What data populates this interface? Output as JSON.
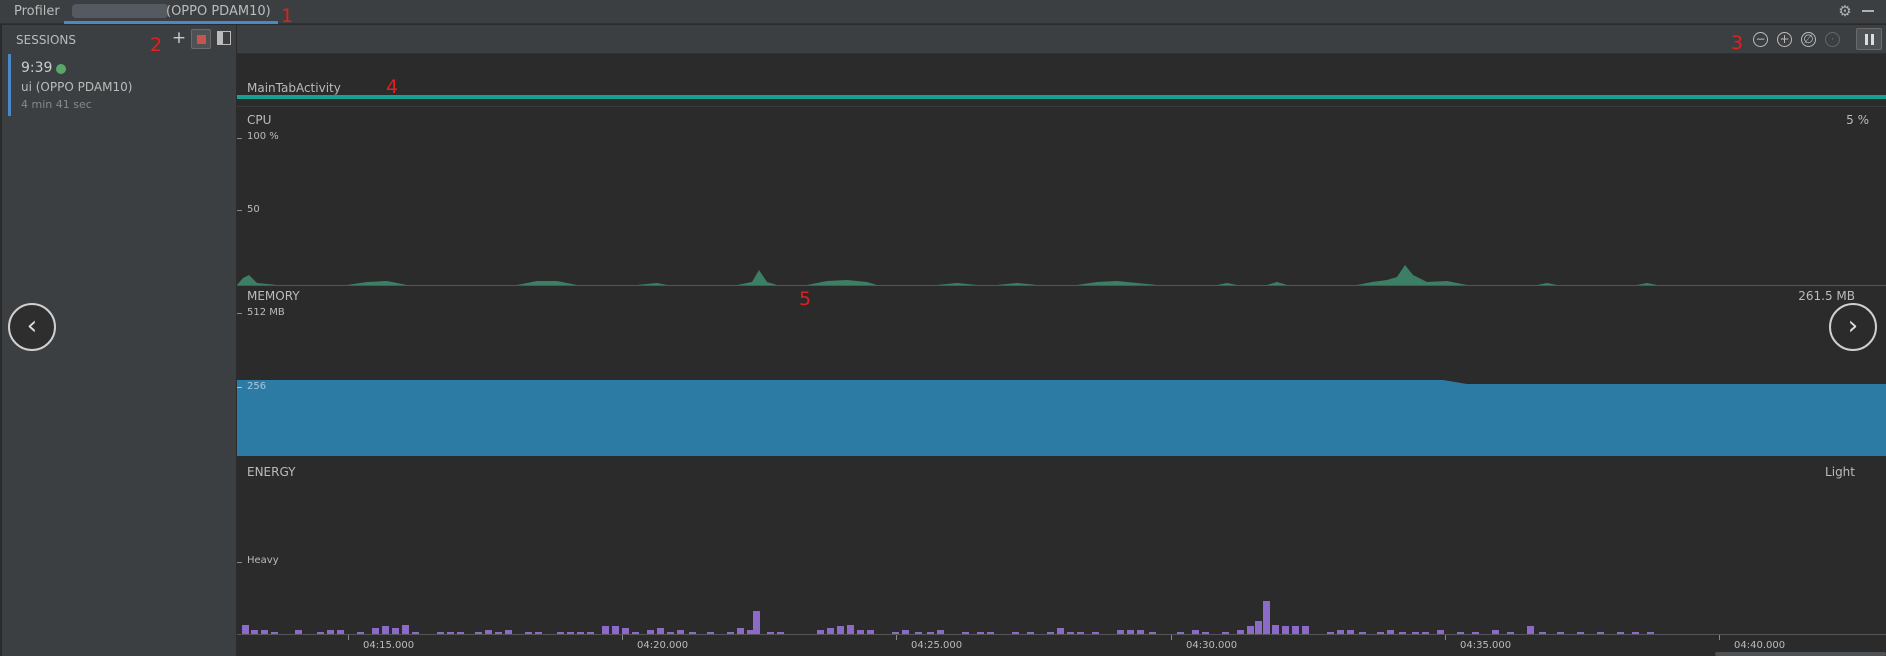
{
  "topbar": {
    "title": "Profiler",
    "tab_label": "(OPPO PDAM10)"
  },
  "annotations": [
    "1",
    "2",
    "3",
    "4",
    "5"
  ],
  "sessions": {
    "header": "SESSIONS",
    "add_label": "+",
    "item": {
      "time": "9:39",
      "device": "ui (OPPO PDAM10)",
      "duration": "4 min 41 sec",
      "status_color": "#59a869"
    }
  },
  "toolbar": {
    "zoom_out_icon": "minus-icon",
    "zoom_in_icon": "plus-icon",
    "reset_zoom_icon": "reset-icon",
    "jump_live_icon": "live-icon",
    "pause_icon": "pause-icon"
  },
  "activity": {
    "label": "MainTabActivity",
    "color": "#17a190"
  },
  "cpu": {
    "label": "CPU",
    "value": "5 %",
    "axis_top": "100 %",
    "axis_mid": "50",
    "color": "#3d7f65"
  },
  "memory": {
    "label": "MEMORY",
    "value": "261.5 MB",
    "axis_top": "512 MB",
    "axis_mid": "256",
    "color": "#2c7ba4"
  },
  "energy": {
    "label": "ENERGY",
    "value": "Light",
    "axis_mid": "Heavy",
    "color": "#8b6bc7"
  },
  "xaxis": {
    "labels": [
      "04:15.000",
      "04:20.000",
      "04:25.000",
      "04:30.000",
      "04:35.000",
      "04:40.000"
    ]
  },
  "nav": {
    "prev": "‹",
    "next": "›"
  }
}
